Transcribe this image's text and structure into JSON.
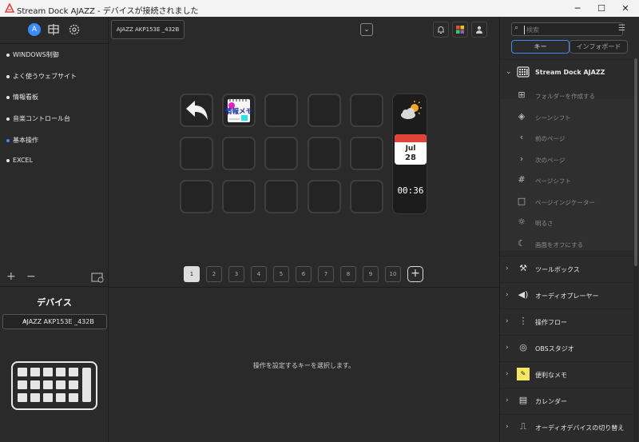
{
  "window": {
    "title": "Stream Dock AJAZZ - デバイスが接続されました",
    "controls": [
      "─",
      "☐",
      "✕"
    ]
  },
  "left": {
    "profiles": [
      {
        "label": "WINDOWS制御",
        "active": false
      },
      {
        "label": "よく使うウェブサイト",
        "active": false
      },
      {
        "label": "情報看板",
        "active": false
      },
      {
        "label": "音楽コントロール台",
        "active": false
      },
      {
        "label": "基本操作",
        "active": true
      },
      {
        "label": "EXCEL",
        "active": false
      }
    ],
    "tools": {
      "add": "+",
      "remove": "−"
    },
    "device_heading": "デバイス",
    "device_select": "AJAZZ AKP153E _432B"
  },
  "center": {
    "device_tab": "AJAZZ AKP153E _432B",
    "keys": {
      "note_label": "情報メモ",
      "calendar_month": "Jul",
      "calendar_day": "28",
      "clock": "00:36"
    },
    "pages": [
      "1",
      "2",
      "3",
      "4",
      "5",
      "6",
      "7",
      "8",
      "9",
      "10"
    ],
    "active_page": "1",
    "add_page": "+",
    "hint": "操作を設定するキーを選択します。"
  },
  "right": {
    "search_placeholder": "検索",
    "tabs": [
      "キー",
      "インフォボード"
    ],
    "active_tab": "キー",
    "open_category": "Stream Dock AJAZZ",
    "sub_items": [
      {
        "icon": "folder-plus-icon",
        "label": "フォルダーを作成する"
      },
      {
        "icon": "layers-icon",
        "label": "シーンシフト"
      },
      {
        "icon": "previous-page-icon",
        "label": "前のページ"
      },
      {
        "icon": "next-page-icon",
        "label": "次のページ"
      },
      {
        "icon": "hash-icon",
        "label": "ページシフト"
      },
      {
        "icon": "square-icon",
        "label": "ページインジケーター"
      },
      {
        "icon": "sun-icon",
        "label": "明るさ"
      },
      {
        "icon": "moon-icon",
        "label": "画面をオフにする"
      }
    ],
    "categories": [
      {
        "icon": "toolbox-icon",
        "label": "ツールボックス"
      },
      {
        "icon": "speaker-icon",
        "label": "オーディオプレーヤー"
      },
      {
        "icon": "flow-icon",
        "label": "操作フロー"
      },
      {
        "icon": "obs-icon",
        "label": "OBSスタジオ"
      },
      {
        "icon": "sticky-note-icon",
        "label": "便利なメモ"
      },
      {
        "icon": "calendar-icon",
        "label": "カレンダー"
      },
      {
        "icon": "audio-device-icon",
        "label": "オーディオデバイスの切り替え"
      }
    ]
  },
  "colors": {
    "accent": "#3a8bff",
    "bg": "#2a2a2a",
    "titlebar": "#f3f3f3"
  }
}
